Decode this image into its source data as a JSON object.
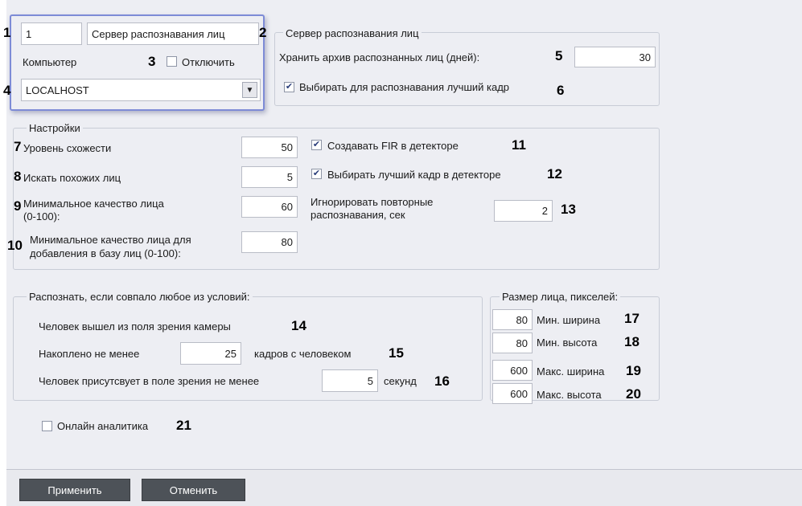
{
  "server": {
    "id_value": "1",
    "name_value": "Сервер распознавания лиц",
    "computer_label": "Компьютер",
    "disable_label": "Отключить",
    "disable_checked": false,
    "computer_value": "LOCALHOST"
  },
  "server_group": {
    "title": "Сервер распознавания лиц",
    "archive_days_label": "Хранить архив распознанных лиц (дней):",
    "archive_days_value": "30",
    "best_frame_label": "Выбирать для распознавания лучший кадр",
    "best_frame_checked": true
  },
  "settings": {
    "title": "Настройки",
    "similarity_label": "Уровень схожести",
    "similarity_value": "50",
    "search_similar_label": "Искать похожих лиц",
    "search_similar_value": "5",
    "min_quality_label_1": "Минимальное качество лица",
    "min_quality_label_2": "(0-100):",
    "min_quality_value": "60",
    "min_quality_db_label_1": "Минимальное качество лица для",
    "min_quality_db_label_2": "добавления в базу лиц (0-100):",
    "min_quality_db_value": "80",
    "create_fir_label": "Создавать FIR в детекторе",
    "create_fir_checked": true,
    "best_frame_detector_label": "Выбирать лучший кадр в детекторе",
    "best_frame_detector_checked": true,
    "ignore_repeat_label_1": "Игнорировать повторные",
    "ignore_repeat_label_2": "распознавания, сек",
    "ignore_repeat_value": "2"
  },
  "recognize": {
    "title": "Распознать, если совпало любое из условий:",
    "left_fov_label": "Человек вышел из поля зрения камеры",
    "accumulated_label": "Накоплено не менее",
    "accumulated_value": "25",
    "frames_label": "кадров с человеком",
    "present_label": "Человек присутсвует в поле зрения не менее",
    "present_value": "5",
    "seconds_label": "секунд"
  },
  "face_size": {
    "title": "Размер лица, пикселей:",
    "min_width_value": "80",
    "min_width_label": "Мин. ширина",
    "min_height_value": "80",
    "min_height_label": "Мин. высота",
    "max_width_value": "600",
    "max_width_label": "Макс. ширина",
    "max_height_value": "600",
    "max_height_label": "Макс. высота"
  },
  "online_analytics": {
    "label": "Онлайн аналитика",
    "checked": false
  },
  "buttons": {
    "apply": "Применить",
    "cancel": "Отменить"
  },
  "callouts": [
    "1",
    "2",
    "3",
    "4",
    "5",
    "6",
    "7",
    "8",
    "9",
    "10",
    "11",
    "12",
    "13",
    "14",
    "15",
    "16",
    "17",
    "18",
    "19",
    "20",
    "21"
  ],
  "colors": {
    "panel_bg": "#edeef3",
    "button_bg": "#4d5258",
    "highlight_border": "#7d8bd6"
  }
}
